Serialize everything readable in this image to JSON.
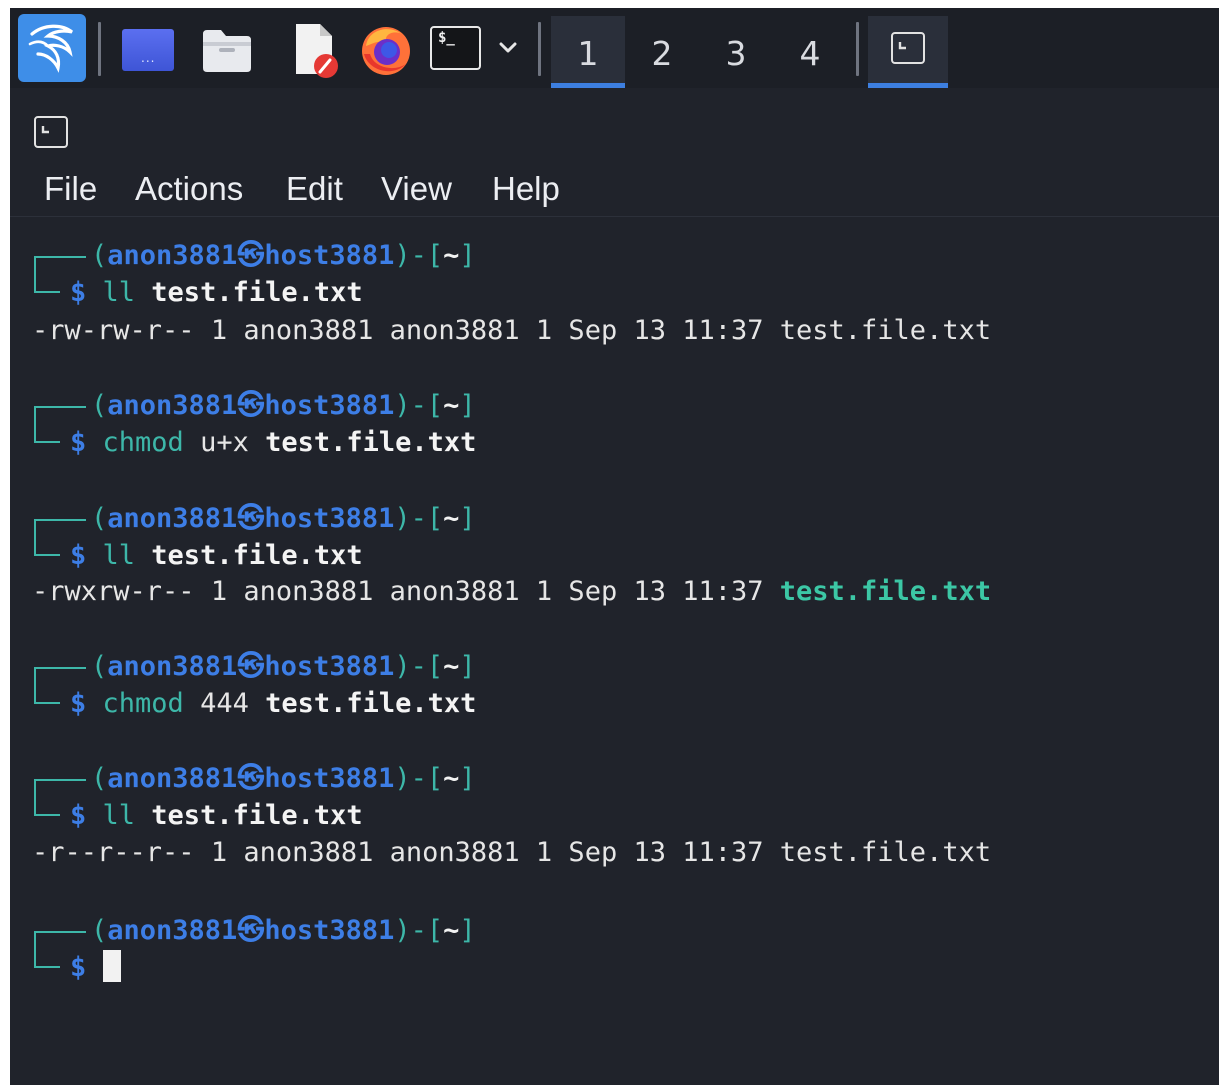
{
  "taskbar": {
    "launchers": [
      {
        "icon": "kali-dragon-icon",
        "label": ""
      },
      {
        "icon": "show-desktop-icon",
        "label": "..."
      },
      {
        "icon": "folder-icon",
        "label": ""
      },
      {
        "icon": "text-editor-icon",
        "label": ""
      },
      {
        "icon": "firefox-icon",
        "label": ""
      },
      {
        "icon": "terminal-icon",
        "label": "$_"
      },
      {
        "icon": "chevron-down-icon",
        "label": ""
      }
    ],
    "workspaces": [
      "1",
      "2",
      "3",
      "4"
    ],
    "active_workspace": "1",
    "open_task_icon": "terminal-window-icon"
  },
  "window": {
    "icon": "terminal-window-icon",
    "menu": [
      "File",
      "Actions",
      "Edit",
      "View",
      "Help"
    ]
  },
  "terminal": {
    "user": "anon3881",
    "host": "host3881",
    "cwd": "~",
    "prompts": [
      {
        "command": "ll",
        "args": "",
        "target": "test.file.txt",
        "output": {
          "perms": "-rw-rw-r--",
          "rest": " 1 anon3881 anon3881 1 Sep 13 11:37 ",
          "name": "test.file.txt",
          "executable": false
        }
      },
      {
        "command": "chmod",
        "args": "u+x",
        "target": "test.file.txt",
        "output": null
      },
      {
        "command": "ll",
        "args": "",
        "target": "test.file.txt",
        "output": {
          "perms": "-rwxrw-r--",
          "rest": " 1 anon3881 anon3881 1 Sep 13 11:37 ",
          "name": "test.file.txt",
          "executable": true
        }
      },
      {
        "command": "chmod",
        "args": "444",
        "target": "test.file.txt",
        "output": null
      },
      {
        "command": "ll",
        "args": "",
        "target": "test.file.txt",
        "output": {
          "perms": "-r--r--r--",
          "rest": " 1 anon3881 anon3881 1 Sep 13 11:37 ",
          "name": "test.file.txt",
          "executable": false
        }
      },
      {
        "command": "",
        "args": "",
        "target": "",
        "output": null
      }
    ]
  },
  "colors": {
    "background": "#20232b",
    "prompt_frame": "#3db7a9",
    "user_host": "#3d7ee6",
    "executable_file": "#3cc7a5",
    "workspace_indicator": "#3d7fe0"
  }
}
